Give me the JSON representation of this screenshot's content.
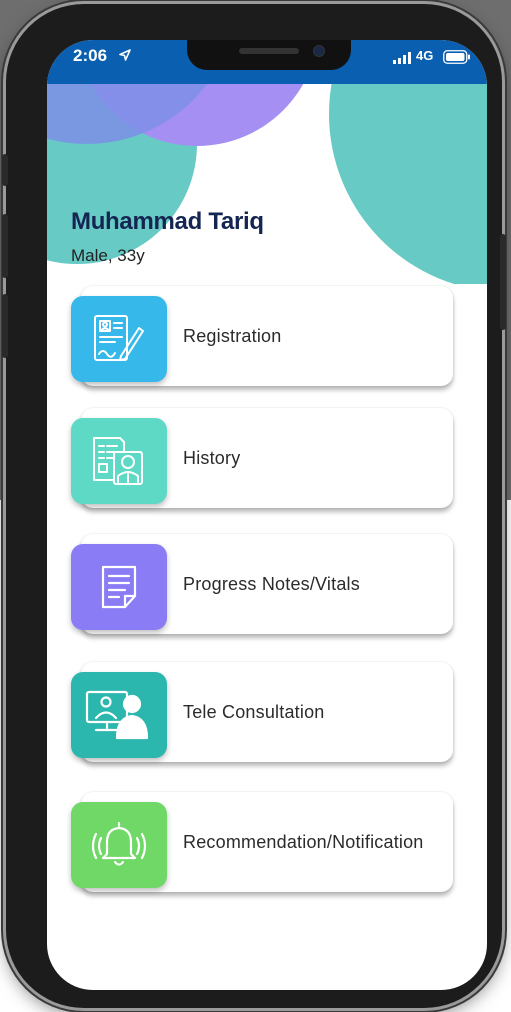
{
  "status_bar": {
    "time": "2:06",
    "network": "4G",
    "time_icon": "location-arrow-icon",
    "signal_icon": "cellular-signal-icon",
    "battery_icon": "battery-icon"
  },
  "patient": {
    "name": "Muhammad Tariq",
    "info": "Male, 33y"
  },
  "colors": {
    "status_bar": "#0a5fb0",
    "teal_decor": "#67cac4",
    "purple_decor": "#a58ff2",
    "name_text": "#142552"
  },
  "menu": [
    {
      "label": "Registration",
      "icon": "registration-form-icon",
      "color": "#37b8ea"
    },
    {
      "label": "History",
      "icon": "patient-history-icon",
      "color": "#5ed9c6"
    },
    {
      "label": "Progress Notes/Vitals",
      "icon": "notes-icon",
      "color": "#8a7cf5"
    },
    {
      "label": "Tele Consultation",
      "icon": "video-consultation-icon",
      "color": "#2bb7ad"
    },
    {
      "label": "Recommendation/Notification",
      "icon": "bell-icon",
      "color": "#6fd866"
    }
  ]
}
